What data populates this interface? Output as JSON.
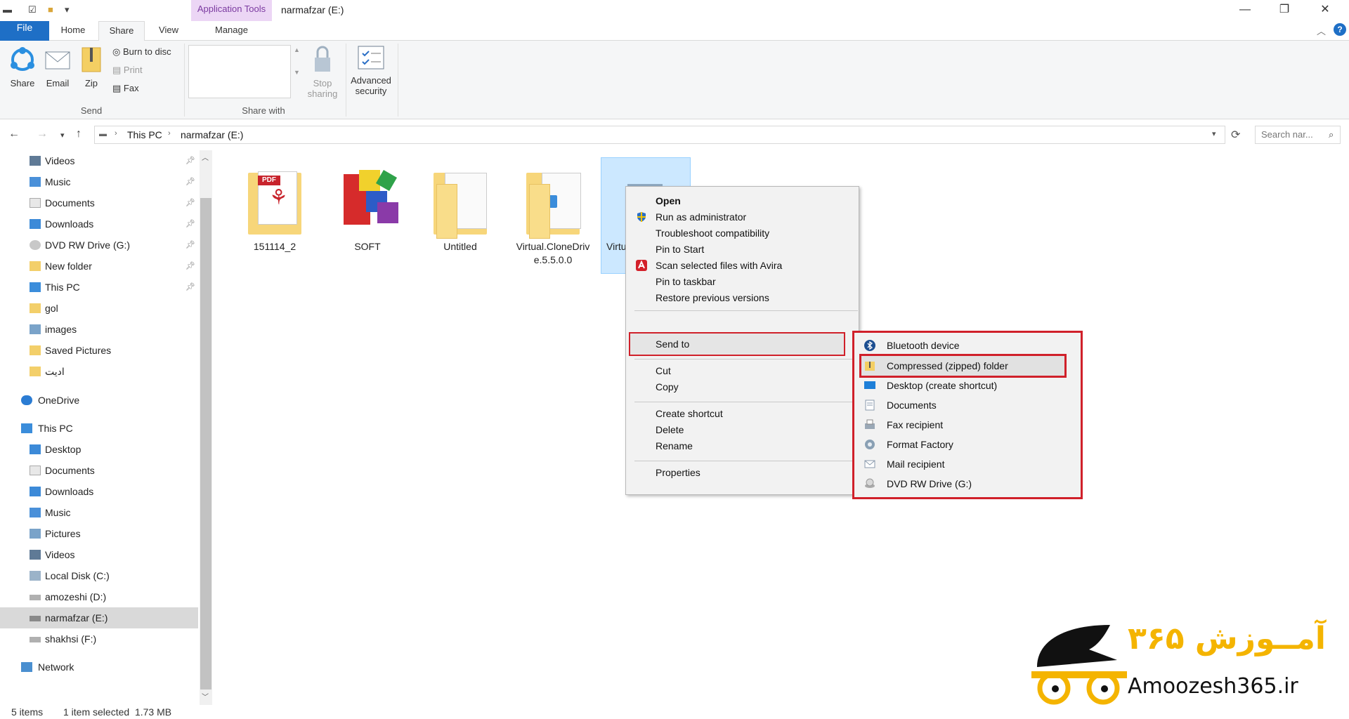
{
  "window": {
    "title": "narmafzar (E:)",
    "context_tab_header": "Application Tools",
    "minimize": "—",
    "restore": "❐",
    "close": "✕"
  },
  "ribbon_tabs": [
    "File",
    "Home",
    "Share",
    "View",
    "Manage"
  ],
  "ribbon": {
    "share": "Share",
    "email": "Email",
    "zip": "Zip",
    "burn": "Burn to disc",
    "print": "Print",
    "fax": "Fax",
    "send_group": "Send",
    "stop_sharing_1": "Stop",
    "stop_sharing_2": "sharing",
    "advanced_1": "Advanced",
    "advanced_2": "security",
    "share_with_group": "Share with"
  },
  "address": {
    "crumbs": [
      "This PC",
      "narmafzar (E:)"
    ],
    "search_placeholder": "Search nar..."
  },
  "nav": {
    "quick_access": [
      {
        "label": "Videos",
        "icon": "videos-folder-icon",
        "pinned": true
      },
      {
        "label": "Music",
        "icon": "music-folder-icon",
        "pinned": true
      },
      {
        "label": "Documents",
        "icon": "documents-folder-icon",
        "pinned": true
      },
      {
        "label": "Downloads",
        "icon": "downloads-folder-icon",
        "pinned": true
      },
      {
        "label": "DVD RW Drive (G:)",
        "icon": "dvd-drive-icon",
        "pinned": true
      },
      {
        "label": "New folder",
        "icon": "folder-icon",
        "pinned": true
      },
      {
        "label": "This PC",
        "icon": "pc-icon",
        "pinned": true
      },
      {
        "label": "gol",
        "icon": "folder-icon",
        "pinned": false
      },
      {
        "label": "images",
        "icon": "images-folder-icon",
        "pinned": false
      },
      {
        "label": "Saved Pictures",
        "icon": "folder-icon",
        "pinned": false
      },
      {
        "label": "ادیت",
        "icon": "folder-icon",
        "pinned": false
      }
    ],
    "onedrive": "OneDrive",
    "this_pc": "This PC",
    "pc_items": [
      {
        "label": "Desktop",
        "icon": "desktop-folder-icon"
      },
      {
        "label": "Documents",
        "icon": "documents-folder-icon"
      },
      {
        "label": "Downloads",
        "icon": "downloads-folder-icon"
      },
      {
        "label": "Music",
        "icon": "music-folder-icon"
      },
      {
        "label": "Pictures",
        "icon": "pictures-folder-icon"
      },
      {
        "label": "Videos",
        "icon": "videos-folder-icon"
      },
      {
        "label": "Local Disk (C:)",
        "icon": "windows-drive-icon"
      },
      {
        "label": "amozeshi (D:)",
        "icon": "drive-icon"
      },
      {
        "label": "narmafzar (E:)",
        "icon": "drive-icon"
      },
      {
        "label": "shakhsi (F:)",
        "icon": "drive-icon"
      }
    ],
    "network": "Network"
  },
  "files": [
    {
      "label": "151114_2",
      "icon": "pdf-folder-icon"
    },
    {
      "label": "SOFT",
      "icon": "winrar-icon"
    },
    {
      "label": "Untitled",
      "icon": "folder-icon"
    },
    {
      "label": "Virtual.CloneDriv e.5.5.0.0",
      "icon": "folder-icon"
    },
    {
      "label": "Virtu e.5.5",
      "icon": "setup-icon"
    }
  ],
  "context_menu": {
    "items": [
      "Open",
      "Run as administrator",
      "Troubleshoot compatibility",
      "Pin to Start",
      "Scan selected files with Avira",
      "Pin to taskbar",
      "Restore previous versions",
      "Send to",
      "Cut",
      "Copy",
      "Create shortcut",
      "Delete",
      "Rename",
      "Properties"
    ]
  },
  "send_to_menu": {
    "items": [
      "Bluetooth device",
      "Compressed (zipped) folder",
      "Desktop (create shortcut)",
      "Documents",
      "Fax recipient",
      "Format Factory",
      "Mail recipient",
      "DVD RW Drive (G:)"
    ]
  },
  "status": {
    "items": "5 items",
    "selected": "1 item selected  1.73 MB"
  },
  "logo": {
    "text": "Amoozesh365.ir",
    "persian": "آمــوزش ۳۶۵"
  },
  "colors": {
    "accent": "#1e6fc6",
    "highlight_red": "#d0202a",
    "selection": "#cce8ff",
    "logo_yellow": "#f4b400"
  }
}
